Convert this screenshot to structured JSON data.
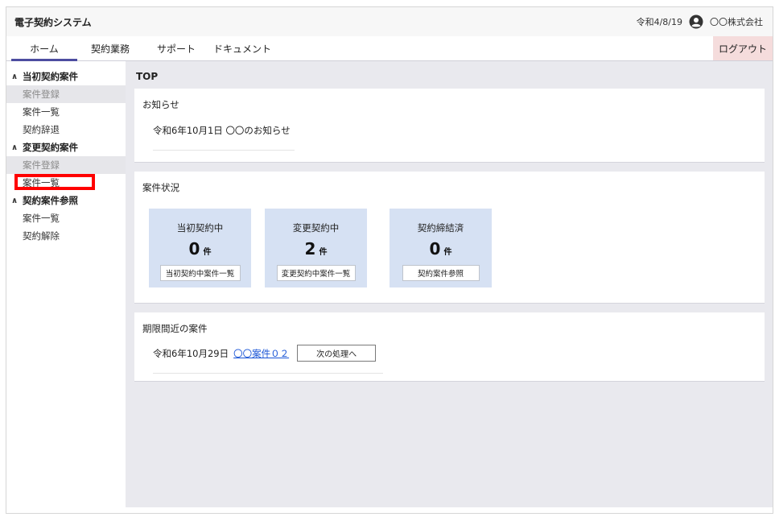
{
  "header": {
    "app_title": "電子契約システム",
    "date": "令和4/8/19",
    "company": "〇〇株式会社",
    "user_icon": "user-circle-icon"
  },
  "nav": {
    "tabs": [
      "ホーム",
      "契約業務",
      "サポート",
      "ドキュメント"
    ],
    "active_tab": "ホーム",
    "logout_label": "ログアウト"
  },
  "sidebar": {
    "sections": [
      {
        "label": "当初契約案件",
        "icon": "chevron-up-icon",
        "items": [
          "案件登録",
          "案件一覧",
          "契約辞退"
        ]
      },
      {
        "label": "変更契約案件",
        "icon": "chevron-up-icon",
        "items": [
          "案件登録",
          "案件一覧"
        ]
      },
      {
        "label": "契約案件参照",
        "icon": "chevron-up-icon",
        "items": [
          "案件一覧",
          "契約解除"
        ]
      }
    ]
  },
  "main": {
    "page_title": "TOP",
    "notice": {
      "title": "お知らせ",
      "date": "令和6年10月1日",
      "text": "〇〇のお知らせ"
    },
    "status": {
      "title": "案件状況",
      "boxes": [
        {
          "label": "当初契約中",
          "count": "0",
          "unit": "件",
          "button": "当初契約中案件一覧"
        },
        {
          "label": "変更契約中",
          "count": "2",
          "unit": "件",
          "button": "変更契約中案件一覧"
        },
        {
          "label": "契約締結済",
          "count": "0",
          "unit": "件",
          "button": "契約案件参照"
        }
      ]
    },
    "deadline": {
      "title": "期限間近の案件",
      "date": "令和6年10月29日",
      "link": "〇〇案件０２",
      "button": "次の処理へ"
    }
  },
  "colors": {
    "accent": "#4d4da0",
    "logout_bg": "#f5dcdc",
    "status_box_bg": "#d6e1f3",
    "link": "#1a55d6",
    "highlight_box": "#ff0000"
  }
}
